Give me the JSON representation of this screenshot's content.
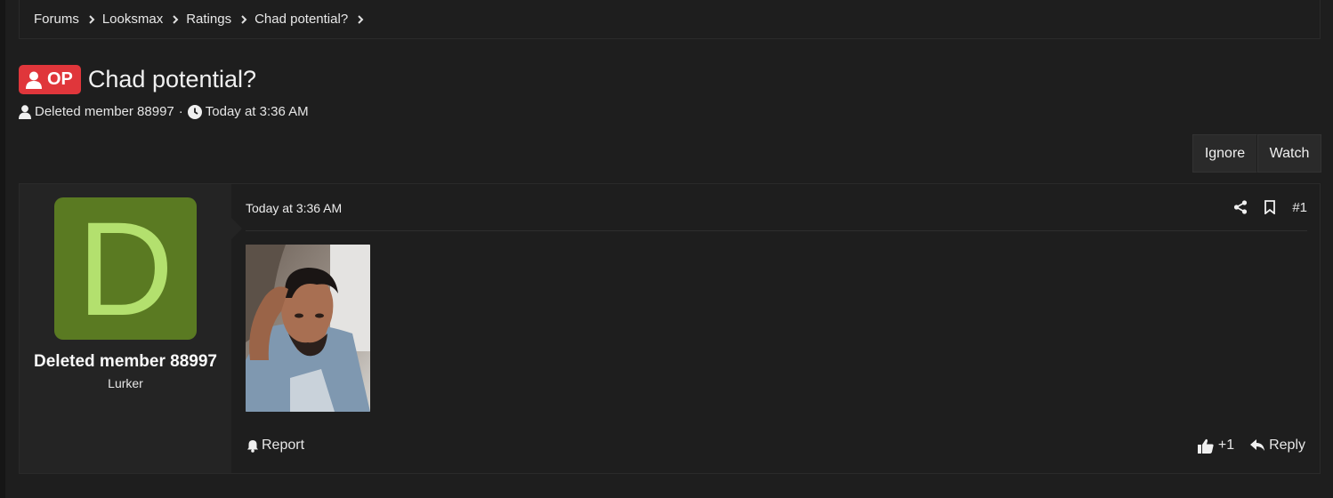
{
  "breadcrumb": [
    {
      "label": "Forums"
    },
    {
      "label": "Looksmax"
    },
    {
      "label": "Ratings"
    },
    {
      "label": "Chad potential?"
    }
  ],
  "thread": {
    "badge": "OP",
    "title": "Chad potential?",
    "author": "Deleted member 88997",
    "separator": "·",
    "time": "Today at 3:36 AM"
  },
  "buttons": {
    "ignore": "Ignore",
    "watch": "Watch"
  },
  "post": {
    "avatar_letter": "D",
    "username": "Deleted member 88997",
    "user_title": "Lurker",
    "date": "Today at 3:36 AM",
    "number": "#1",
    "report": "Report",
    "reaction_count": "+1",
    "reply": "Reply"
  },
  "colors": {
    "background": "#1e1e1e",
    "badge": "#e0363b",
    "avatar_bg": "#5a7a22",
    "avatar_letter": "#b3e06e"
  }
}
